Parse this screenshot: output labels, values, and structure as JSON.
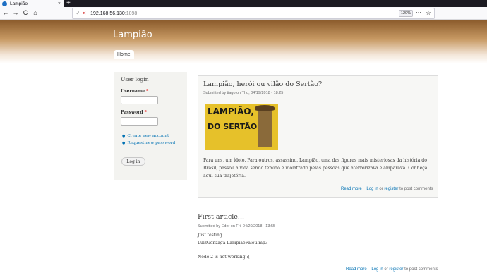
{
  "browser": {
    "tab_title": "Lampião",
    "tab_close": "×",
    "new_tab": "+",
    "back": "←",
    "forward": "→",
    "reload": "C",
    "home": "⌂",
    "url_host": "192.168.56.130",
    "url_port": ":1898",
    "zoom": "120%",
    "bookmarks": "⋯",
    "star": "☆"
  },
  "site": {
    "name": "Lampião",
    "nav_home": "Home"
  },
  "login": {
    "title": "User login",
    "username_label": "Username",
    "password_label": "Password",
    "required_mark": "*",
    "create_account": "Create new account",
    "request_password": "Request new password",
    "submit": "Log in"
  },
  "article1": {
    "title": "Lampião, herói ou vilão do Sertão?",
    "meta": "Submitted by tiago on Thu, 04/19/2018 - 18:25",
    "image_text_1": "LAMPIÃO,",
    "image_text_2": "DO SERTÃO",
    "body": "Para uns, um ídolo. Para outros, assassino. Lampião, uma das figuras mais misteriosas da história do Brasil, passou a vida sendo temido e idolatrado pelas pessoas que aterrorizava e amparava. Conheça aqui sua trajetória.",
    "read_more": "Read more",
    "log_in": "Log in",
    "or": "or",
    "register": "register",
    "to_post": "to post comments"
  },
  "article2": {
    "title": "First article...",
    "meta": "Submitted by Eder on Fri, 04/20/2018 - 13:55",
    "line1": "Just testing..",
    "line2": "LuizGonzaga-LampiaoFalou.mp3",
    "line3": "Node 2 is not working :(",
    "read_more": "Read more",
    "log_in": "Log in",
    "or": "or",
    "register": "register",
    "to_post": "to post comments"
  },
  "colors": {
    "link": "#0071b3",
    "header_top": "#8a5a2b",
    "image_bg": "#e6c12a"
  }
}
